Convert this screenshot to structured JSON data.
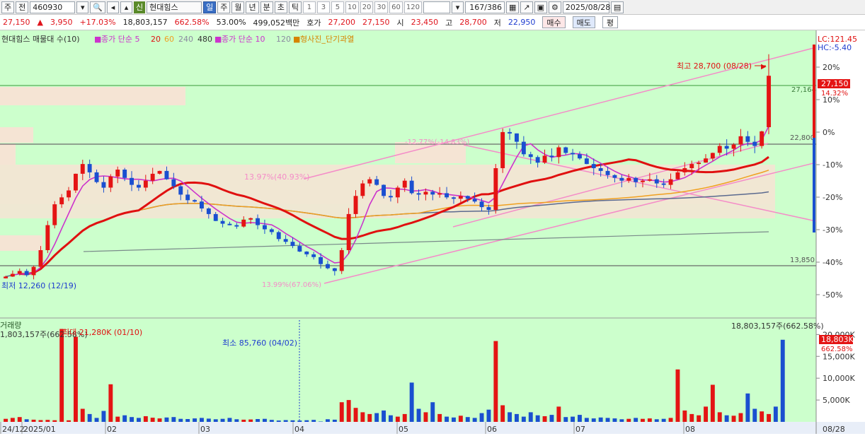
{
  "toolbar": {
    "market_label": "주",
    "period_label": "전",
    "code": "460930",
    "stock_badge": "신",
    "stock_name": "현대힘스",
    "period_buttons": [
      "일",
      "주",
      "월",
      "년",
      "분",
      "초",
      "틱"
    ],
    "interval_buttons": [
      "1",
      "3",
      "5",
      "10",
      "20",
      "30",
      "60",
      "120"
    ],
    "count": "167/386",
    "date": "2025/08/28"
  },
  "info": {
    "price": "27,150",
    "change": "3,950",
    "change_pct": "+17.03%",
    "volume": "18,803,157",
    "volume_ratio": "662.58%",
    "ratio2": "53.00%",
    "amount": "499,052백만",
    "bid_label": "호가",
    "bid1": "27,200",
    "bid2": "27,150",
    "open_label": "시",
    "open": "23,450",
    "high_label": "고",
    "high": "28,700",
    "low_label": "저",
    "low": "22,950",
    "sell_button": "매수",
    "buy_button": "매도",
    "eval_button": "평"
  },
  "legend": {
    "title": "현대힘스 매물대 수(10)",
    "ma_price_label": "종가 단순 5",
    "ma_price_periods": [
      "20",
      "60",
      "240",
      "480"
    ],
    "ma_vol_label": "종가 단순 10",
    "ma_vol_period": "120",
    "signal_label": "형사진_단기과열"
  },
  "annotations": {
    "max_label": "최고 28,700 (08/28)",
    "min_label": "최저 12,260 (12/19)",
    "lc_label": "LC:121.45",
    "hc_label": "HC:-5.40",
    "pct_a": "-12.77%(-14.83%)",
    "pct_b": "13.97%(40.93%)",
    "pct_c": "13.99%(67.06%)",
    "level_upper": "27,164",
    "level_mid": "22,800",
    "level_low": "13,850",
    "current_price_tag": "27,150",
    "current_pct_tag": "14.32%"
  },
  "volume_panel": {
    "title": "거래량",
    "current_value": "1,803,157주(662.58%)",
    "max_label": "최대 21,280K (01/10)",
    "min_label": "최소 85,760 (04/02)",
    "top_right_label": "18,803,157주(662.58%)",
    "current_tag": "18,803K",
    "current_pct_tag": "662.58%"
  },
  "colors": {
    "chart_bg": "#ccffcc",
    "up": "#e41414",
    "down": "#1a4fd0",
    "ma5": "#cc33cc",
    "ma20": "#e01010",
    "ma60": "#f0a020",
    "ma240": "#5b6a8f",
    "ma480": "#7a8a8a",
    "trend": "#f48cc8"
  },
  "chart_data": {
    "type": "candlestick",
    "title": "현대힘스 매물대 수(10)",
    "x_ticks": [
      "24/12",
      "2025/01",
      "02",
      "03",
      "04",
      "05",
      "06",
      "07",
      "08"
    ],
    "y_ticks_pct": [
      "20%",
      "10%",
      "0%",
      "-10%",
      "-20%",
      "-30%",
      "-40%",
      "-50%"
    ],
    "price_range": [
      11500,
      29500
    ],
    "highest": {
      "value": 28700,
      "date": "08/28"
    },
    "lowest": {
      "value": 12260,
      "date": "12/19"
    },
    "last": {
      "open": 23450,
      "high": 28700,
      "low": 22950,
      "close": 27150
    },
    "close_series": [
      12700,
      12900,
      13100,
      12800,
      13400,
      14600,
      16400,
      17900,
      18400,
      18900,
      20100,
      20800,
      20200,
      19500,
      19100,
      19900,
      20400,
      19800,
      19300,
      19100,
      19600,
      20100,
      20300,
      19700,
      19200,
      18600,
      18200,
      18100,
      17600,
      17200,
      16700,
      16500,
      16400,
      16300,
      16800,
      16900,
      16400,
      16100,
      15900,
      15400,
      15200,
      14900,
      14500,
      14300,
      14100,
      13600,
      13300,
      13100,
      14600,
      17200,
      18500,
      19400,
      19700,
      19300,
      18500,
      18400,
      19100,
      19600,
      18700,
      18600,
      18800,
      18600,
      18700,
      18400,
      18300,
      18500,
      18300,
      18100,
      17700,
      17500,
      20500,
      23100,
      23000,
      22400,
      21500,
      21300,
      20900,
      21400,
      21300,
      22000,
      21600,
      21500,
      21200,
      20800,
      20500,
      20300,
      20000,
      19800,
      19600,
      19800,
      19500,
      19600,
      19700,
      19400,
      19300,
      19700,
      20200,
      20500,
      20800,
      20900,
      21200,
      21600,
      22100,
      21900,
      22200,
      22800,
      22400,
      22100,
      23150,
      27150
    ],
    "volume_k": [
      700,
      900,
      1100,
      600,
      500,
      400,
      450,
      380,
      21280,
      350,
      19500,
      3000,
      1800,
      900,
      2500,
      8600,
      1200,
      1500,
      1100,
      900,
      1300,
      950,
      800,
      1000,
      1100,
      700,
      650,
      800,
      900,
      750,
      600,
      700,
      900,
      600,
      500,
      550,
      650,
      700,
      450,
      300,
      400,
      350,
      300,
      380,
      450,
      85.76,
      600,
      500,
      4500,
      5000,
      3200,
      2200,
      1800,
      2000,
      2600,
      1500,
      1200,
      1800,
      9000,
      3000,
      2200,
      4500,
      1800,
      1200,
      1000,
      1400,
      1100,
      900,
      2000,
      2800,
      18500,
      3800,
      2200,
      1800,
      1200,
      2200,
      1500,
      1300,
      1600,
      3500,
      1100,
      1200,
      1600,
      900,
      800,
      1000,
      900,
      800,
      600,
      700,
      900,
      700,
      800,
      600,
      700,
      900,
      12000,
      2600,
      1800,
      1500,
      3500,
      8500,
      2200,
      1500,
      1400,
      2000,
      6500,
      3000,
      2400,
      1800,
      3500,
      18800
    ]
  }
}
